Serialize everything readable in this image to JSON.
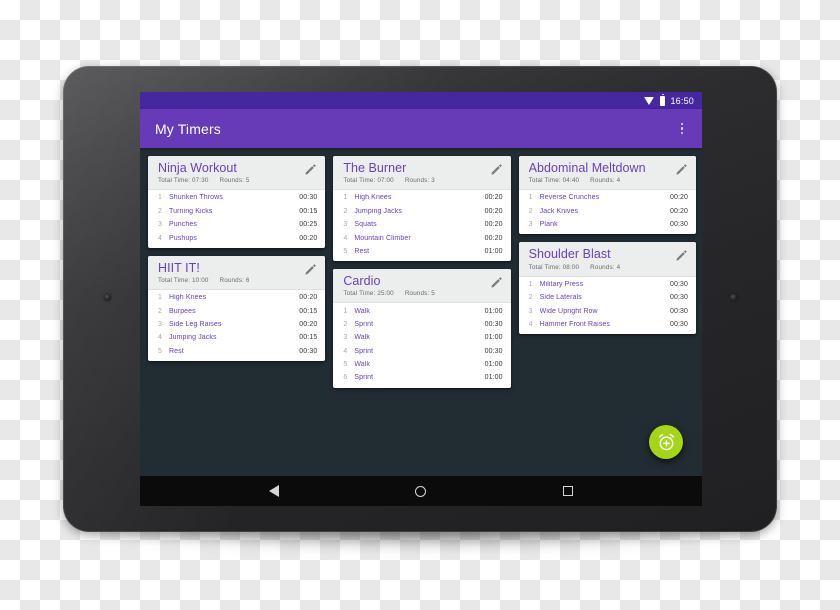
{
  "device": {
    "type": "android-tablet",
    "orientation": "landscape"
  },
  "status_bar": {
    "time": "16:50",
    "wifi_icon": "wifi-icon",
    "battery_icon": "battery-icon",
    "background_color": "#4527a0"
  },
  "app_bar": {
    "title": "My Timers",
    "overflow_icon": "more-vertical-icon",
    "background_color": "#673ab7",
    "text_color": "#ffffff"
  },
  "theme": {
    "accent": "#6a3fc0",
    "screen_background": "#222c33",
    "card_background": "#ffffff",
    "card_header_background": "#eceded",
    "fab_color": "#a4d519"
  },
  "fab": {
    "icon": "alarm-add-icon",
    "label": "Add timer"
  },
  "nav_bar": {
    "back_label": "Back",
    "home_label": "Home",
    "recents_label": "Recents"
  },
  "labels": {
    "total_time_prefix": "Total Time:",
    "rounds_prefix": "Rounds:",
    "edit_icon": "pencil-icon"
  },
  "columns": [
    {
      "cards": [
        {
          "title": "Ninja Workout",
          "total_time": "Total Time: 07:30",
          "rounds": "Rounds: 5",
          "rows": [
            {
              "index": "1",
              "name": "Shuriken Throws",
              "time": "00:30"
            },
            {
              "index": "2",
              "name": "Turning Kicks",
              "time": "00:15"
            },
            {
              "index": "3",
              "name": "Punches",
              "time": "00:25"
            },
            {
              "index": "4",
              "name": "Pushups",
              "time": "00:20"
            }
          ]
        },
        {
          "title": "HIIT IT!",
          "total_time": "Total Time: 10:00",
          "rounds": "Rounds: 6",
          "rows": [
            {
              "index": "1",
              "name": "High Knees",
              "time": "00:20"
            },
            {
              "index": "2",
              "name": "Burpees",
              "time": "00:15"
            },
            {
              "index": "3",
              "name": "Side Leg Raises",
              "time": "00:20"
            },
            {
              "index": "4",
              "name": "Jumping Jacks",
              "time": "00:15"
            },
            {
              "index": "5",
              "name": "Rest",
              "time": "00:30"
            }
          ]
        }
      ]
    },
    {
      "cards": [
        {
          "title": "The Burner",
          "total_time": "Total Time: 07:00",
          "rounds": "Rounds: 3",
          "rows": [
            {
              "index": "1",
              "name": "High Knees",
              "time": "00:20"
            },
            {
              "index": "2",
              "name": "Jumping Jacks",
              "time": "00:20"
            },
            {
              "index": "3",
              "name": "Squats",
              "time": "00:20"
            },
            {
              "index": "4",
              "name": "Mountain Climber",
              "time": "00:20"
            },
            {
              "index": "5",
              "name": "Rest",
              "time": "01:00"
            }
          ]
        },
        {
          "title": "Cardio",
          "total_time": "Total Time: 25:00",
          "rounds": "Rounds: 5",
          "rows": [
            {
              "index": "1",
              "name": "Walk",
              "time": "01:00"
            },
            {
              "index": "2",
              "name": "Sprint",
              "time": "00:30"
            },
            {
              "index": "3",
              "name": "Walk",
              "time": "01:00"
            },
            {
              "index": "4",
              "name": "Sprint",
              "time": "00:30"
            },
            {
              "index": "5",
              "name": "Walk",
              "time": "01:00"
            },
            {
              "index": "6",
              "name": "Sprint",
              "time": "01:00"
            }
          ]
        }
      ]
    },
    {
      "cards": [
        {
          "title": "Abdominal Meltdown",
          "total_time": "Total Time: 04:40",
          "rounds": "Rounds: 4",
          "rows": [
            {
              "index": "1",
              "name": "Reverse Crunches",
              "time": "00:20"
            },
            {
              "index": "2",
              "name": "Jack Knives",
              "time": "00:20"
            },
            {
              "index": "3",
              "name": "Plank",
              "time": "00:30"
            }
          ]
        },
        {
          "title": "Shoulder Blast",
          "total_time": "Total Time: 08:00",
          "rounds": "Rounds: 4",
          "rows": [
            {
              "index": "1",
              "name": "Military Press",
              "time": "00:30"
            },
            {
              "index": "2",
              "name": "Side Laterals",
              "time": "00:30"
            },
            {
              "index": "3",
              "name": "Wide Upright Row",
              "time": "00:30"
            },
            {
              "index": "4",
              "name": "Hammer Front Raises",
              "time": "00:30"
            }
          ]
        }
      ]
    }
  ]
}
